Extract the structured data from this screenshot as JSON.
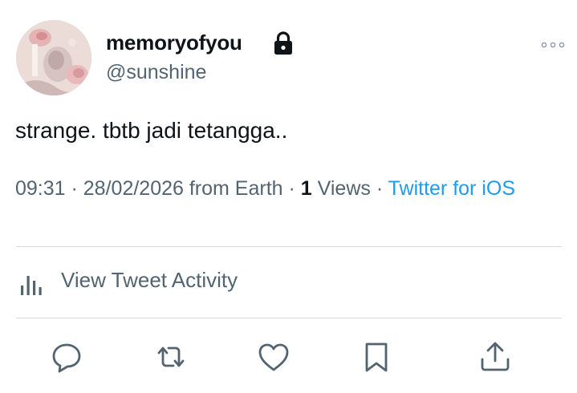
{
  "author": {
    "display_name": "memoryofyou",
    "handle": "@sunshine",
    "locked": true
  },
  "tweet": {
    "text": "strange. tbtb jadi tetangga.."
  },
  "meta": {
    "time": "09:31",
    "sep1": " · ",
    "date": "28/02/2026",
    "location": " from Earth",
    "sep2": " · ",
    "views_count": "1",
    "views_label": " Views",
    "sep3": " · ",
    "source": "Twitter for iOS"
  },
  "activity": {
    "label": "View Tweet Activity"
  },
  "actions": [
    "reply-icon",
    "retweet-icon",
    "like-icon",
    "bookmark-icon",
    "share-icon"
  ],
  "colors": {
    "text": "#0f1419",
    "secondary": "#536471",
    "link": "#1d9bf0",
    "divider": "#cfd9de"
  }
}
